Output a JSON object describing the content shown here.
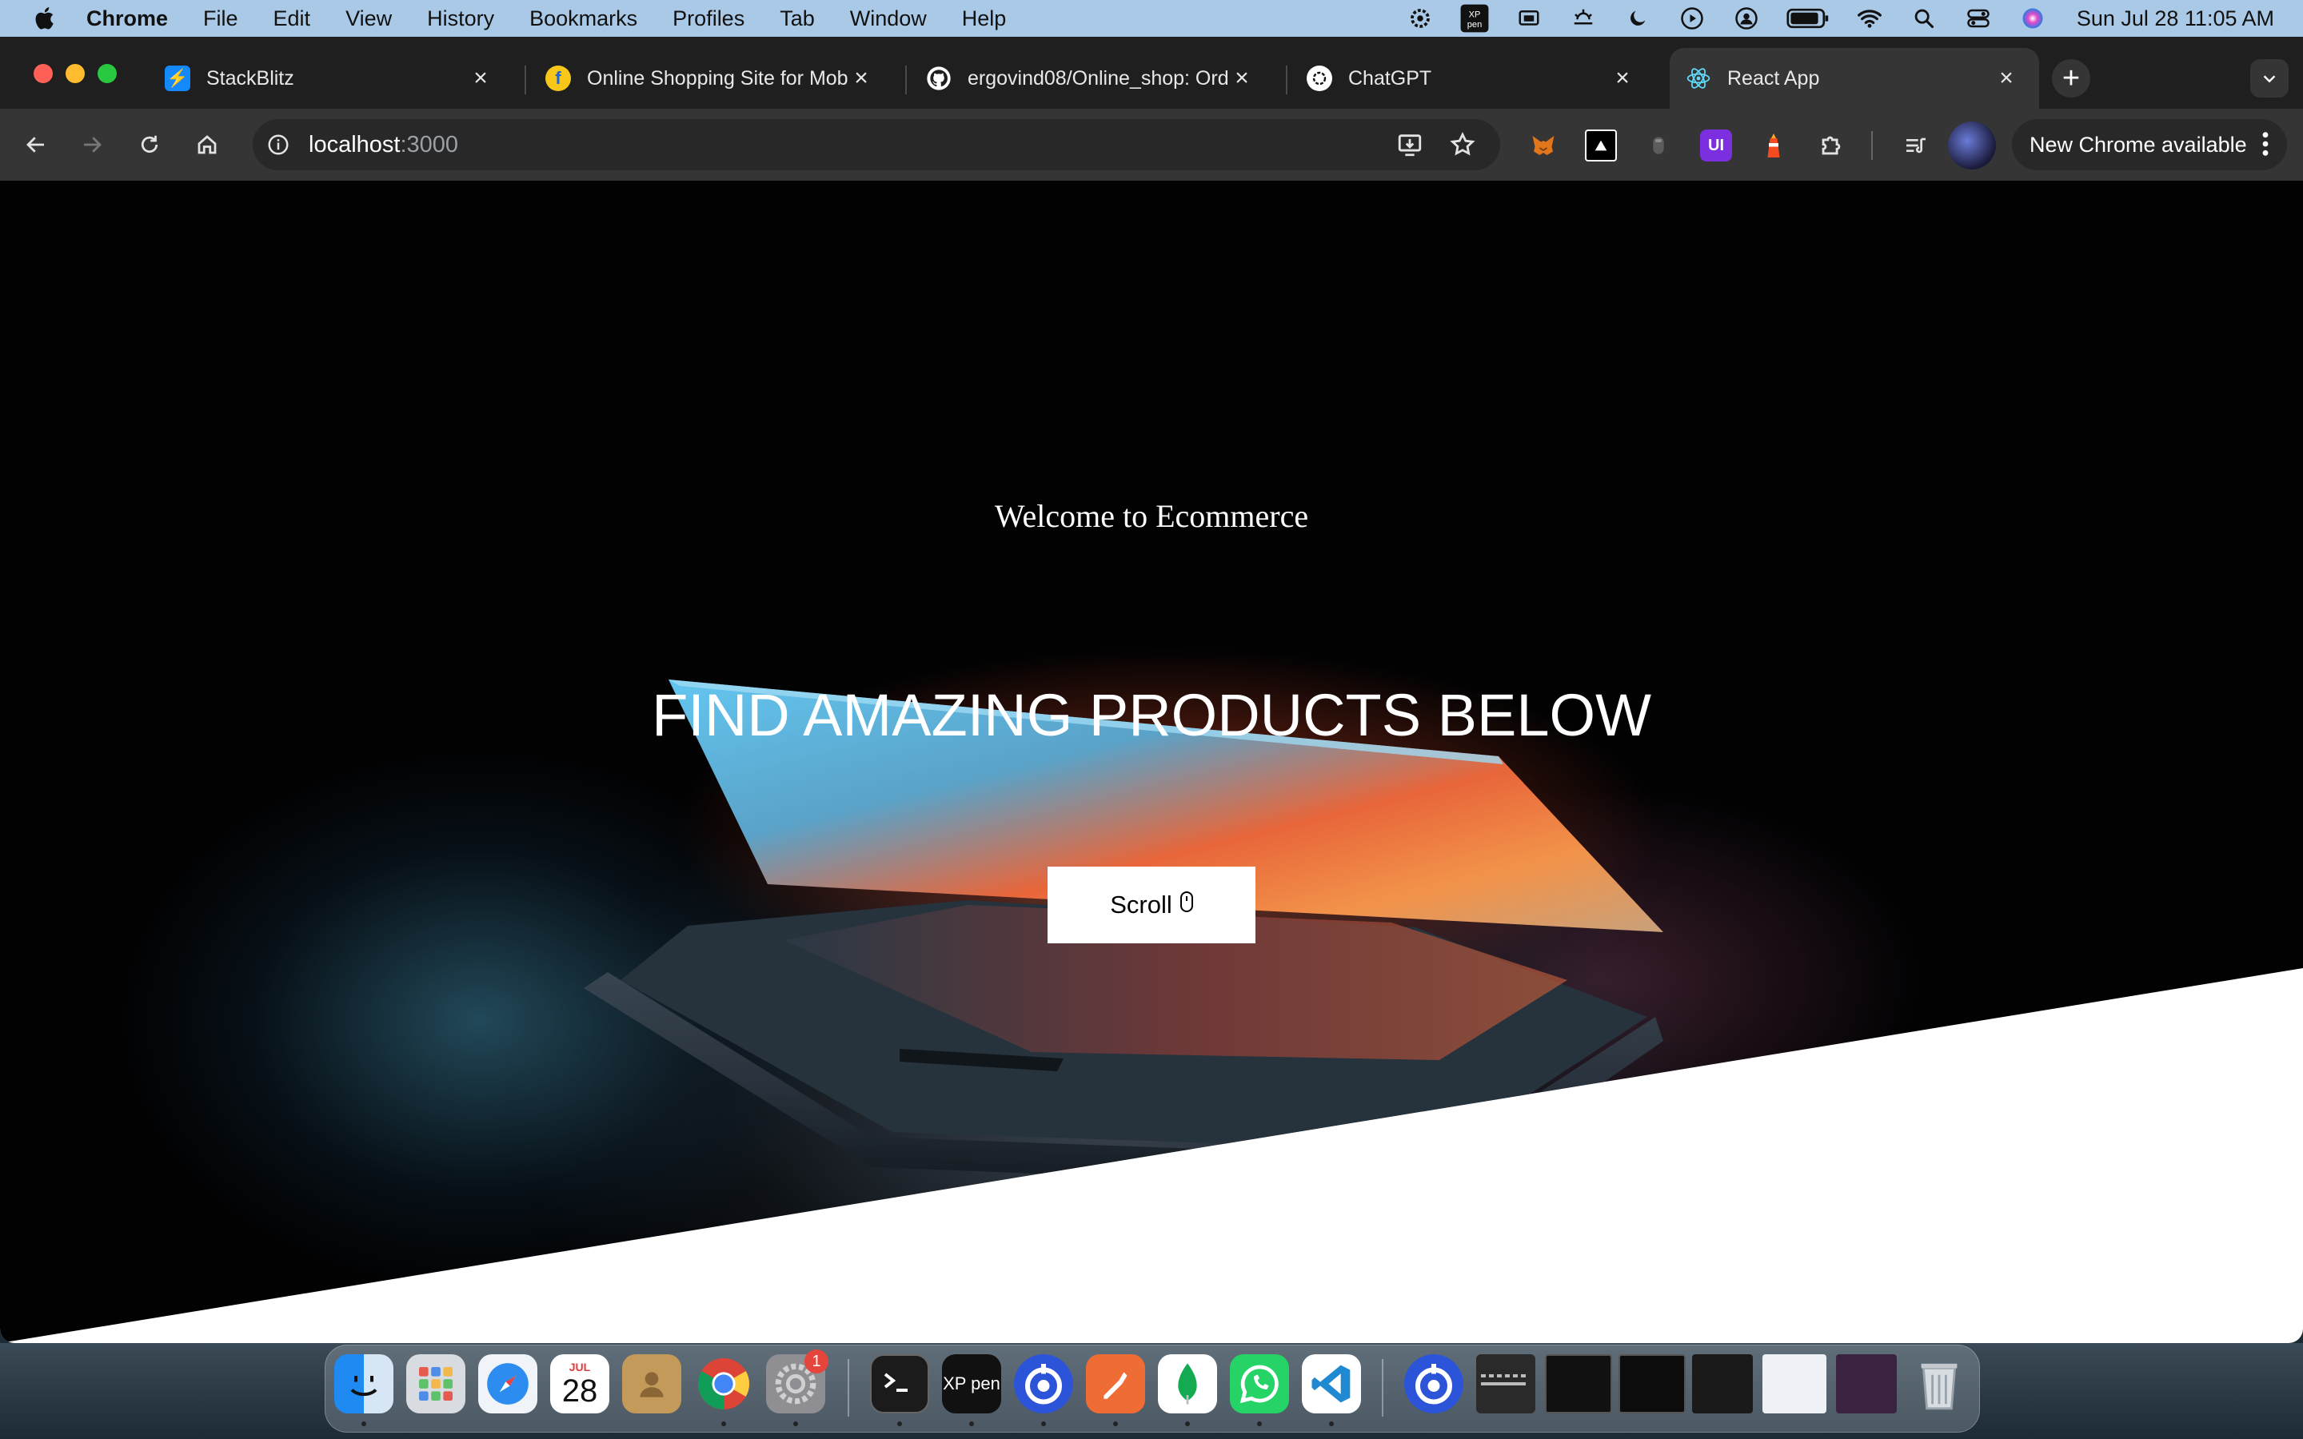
{
  "menubar": {
    "app_name": "Chrome",
    "menus": [
      "File",
      "Edit",
      "View",
      "History",
      "Bookmarks",
      "Profiles",
      "Tab",
      "Window",
      "Help"
    ],
    "clock": "Sun Jul 28  11:05 AM",
    "status_icons": [
      "gear-icon",
      "xp-pen-icon",
      "screen-mirroring-icon",
      "sunrise-icon",
      "moon-icon",
      "play-icon",
      "user-icon",
      "battery-icon",
      "wifi-icon",
      "spotlight-icon",
      "control-center-icon",
      "siri-icon"
    ]
  },
  "tabs": [
    {
      "title": "StackBlitz",
      "favicon": "stackblitz-icon",
      "active": false
    },
    {
      "title": "Online Shopping Site for Mobi",
      "favicon": "flipkart-icon",
      "active": false
    },
    {
      "title": "ergovind08/Online_shop: Ord",
      "favicon": "github-icon",
      "active": false
    },
    {
      "title": "ChatGPT",
      "favicon": "chatgpt-icon",
      "active": false
    },
    {
      "title": "React App",
      "favicon": "react-icon",
      "active": true
    }
  ],
  "toolbar": {
    "url_host": "localhost",
    "url_port": ":3000",
    "update_label": "New Chrome available",
    "extensions": [
      "metamask-icon",
      "notion-icon",
      "shield-icon",
      "ui-extension-icon",
      "lighthouse-icon",
      "puzzle-icon"
    ]
  },
  "page": {
    "welcome": "Welcome to Ecommerce",
    "headline": "FIND AMAZING PRODUCTS BELOW",
    "scroll_label": "Scroll"
  },
  "dock": {
    "apps": [
      "Finder",
      "Launchpad",
      "Safari",
      "Calendar",
      "Contacts",
      "Chrome",
      "System Settings",
      "Terminal",
      "XP-Pen",
      "Pen Tablet",
      "Postman",
      "MongoDB Compass",
      "WhatsApp",
      "VS Code"
    ],
    "calendar_month": "JUL",
    "calendar_day": "28",
    "settings_badge": "1",
    "xppen_label": "XP pen"
  },
  "colors": {
    "menubar_bg": "#a9c9e6",
    "tabstrip_bg": "#1f1f1f",
    "toolbar_bg": "#353535",
    "omnibox_bg": "#282828",
    "page_bg": "#000000",
    "button_bg": "#ffffff"
  }
}
